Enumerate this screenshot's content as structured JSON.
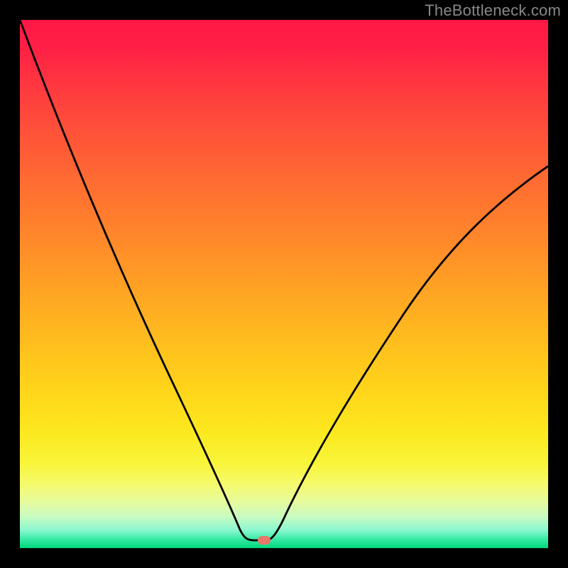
{
  "watermark": "TheBottleneck.com",
  "chart_data": {
    "type": "line",
    "title": "",
    "xlabel": "",
    "ylabel": "",
    "xlim": [
      0,
      100
    ],
    "ylim": [
      0,
      100
    ],
    "grid": false,
    "series": [
      {
        "name": "bottleneck-curve",
        "x": [
          0,
          5,
          10,
          15,
          20,
          25,
          30,
          35,
          40,
          42,
          45,
          47,
          50,
          55,
          60,
          65,
          70,
          75,
          80,
          85,
          90,
          95,
          100
        ],
        "y": [
          100,
          89,
          79,
          69,
          59,
          49,
          40,
          30,
          18,
          10,
          1.5,
          1.2,
          4,
          12,
          21,
          29,
          37,
          44,
          51,
          57,
          63,
          68,
          72
        ]
      }
    ],
    "marker": {
      "x": 46,
      "y": 1.4,
      "color": "#e8776a"
    },
    "background_gradient": {
      "top": "#ff1846",
      "middle": "#ffd51a",
      "bottom": "#00d77a"
    }
  }
}
